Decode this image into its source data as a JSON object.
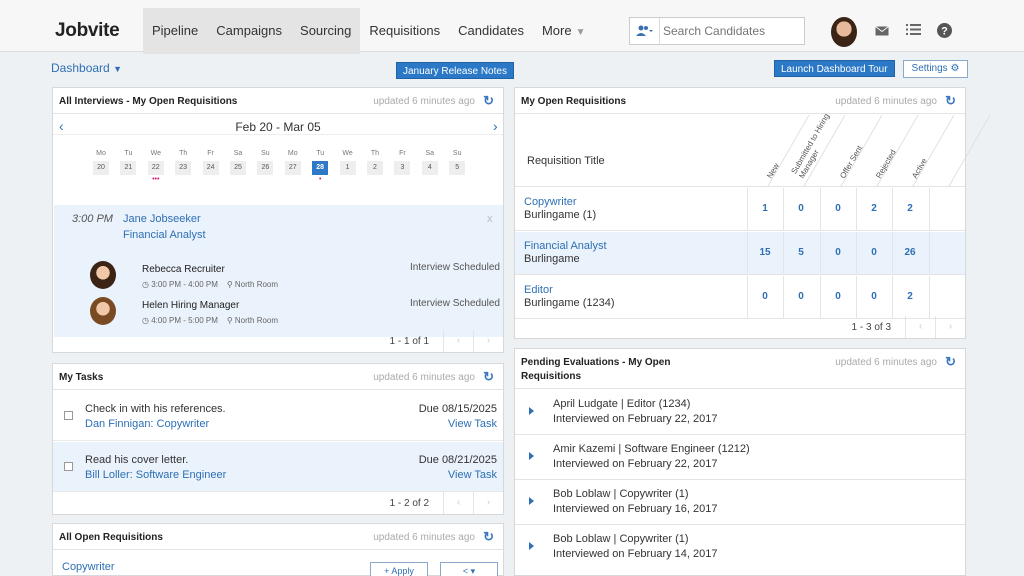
{
  "app": {
    "logo": "Jobvite"
  },
  "nav": {
    "items": [
      {
        "label": "Pipeline"
      },
      {
        "label": "Campaigns"
      },
      {
        "label": "Sourcing"
      },
      {
        "label": "Requisitions"
      },
      {
        "label": "Candidates"
      },
      {
        "label": "More"
      }
    ],
    "search_placeholder": "Search Candidates"
  },
  "toolbar": {
    "dashboard": "Dashboard",
    "release_notes": "January Release Notes",
    "launch_tour": "Launch Dashboard Tour",
    "settings": "Settings"
  },
  "interviews": {
    "title": "All Interviews - My Open Requisitions",
    "updated": "updated 6 minutes ago",
    "range": "Feb 20 - Mar 05",
    "days": [
      {
        "name": "Mo",
        "num": "20"
      },
      {
        "name": "Tu",
        "num": "21"
      },
      {
        "name": "We",
        "num": "22"
      },
      {
        "name": "Th",
        "num": "23"
      },
      {
        "name": "Fr",
        "num": "24"
      },
      {
        "name": "Sa",
        "num": "25"
      },
      {
        "name": "Su",
        "num": "26"
      },
      {
        "name": "Mo",
        "num": "27"
      },
      {
        "name": "Tu",
        "num": "28"
      },
      {
        "name": "We",
        "num": "1"
      },
      {
        "name": "Th",
        "num": "2"
      },
      {
        "name": "Fr",
        "num": "3"
      },
      {
        "name": "Sa",
        "num": "4"
      },
      {
        "name": "Su",
        "num": "5"
      }
    ],
    "dots_we": "•••",
    "dots_tu": "•",
    "time": "3:00 PM",
    "candidate": "Jane Jobseeker",
    "role": "Financial Analyst",
    "close": "x",
    "people": [
      {
        "name": "Rebecca Recruiter",
        "time": "3:00 PM - 4:00 PM",
        "room": "North Room",
        "status": "Interview Scheduled"
      },
      {
        "name": "Helen Hiring Manager",
        "time": "4:00 PM - 5:00 PM",
        "room": "North Room",
        "status": "Interview Scheduled"
      }
    ],
    "pager": "1 - 1 of 1"
  },
  "tasks": {
    "title": "My Tasks",
    "updated": "updated 6 minutes ago",
    "items": [
      {
        "text": "Check in with his references.",
        "link": "Dan Finnigan: Copywriter",
        "due": "Due 08/15/2025",
        "view": "View Task"
      },
      {
        "text": "Read his cover letter.",
        "link": "Bill Loller: Software Engineer",
        "due": "Due 08/21/2025",
        "view": "View Task"
      }
    ],
    "pager": "1 - 2 of 2"
  },
  "all_reqs": {
    "title": "All Open Requisitions",
    "updated": "updated 6 minutes ago",
    "first": "Copywriter",
    "apply": "+ Apply",
    "share": "< ▾"
  },
  "my_reqs": {
    "title": "My Open Requisitions",
    "updated": "updated 6 minutes ago",
    "col_title": "Requisition Title",
    "cols": [
      "New",
      "Submitted to Hiring Manager",
      "Offer Sent",
      "Rejected",
      "Active"
    ],
    "rows": [
      {
        "name": "Copywriter",
        "loc": "Burlingame (1)",
        "vals": [
          "1",
          "0",
          "0",
          "2",
          "2"
        ]
      },
      {
        "name": "Financial Analyst",
        "loc": "Burlingame",
        "vals": [
          "15",
          "5",
          "0",
          "0",
          "26"
        ]
      },
      {
        "name": "Editor",
        "loc": "Burlingame (1234)",
        "vals": [
          "0",
          "0",
          "0",
          "0",
          "2"
        ]
      }
    ],
    "pager": "1 - 3 of 3"
  },
  "evals": {
    "title_1": "Pending Evaluations - My Open",
    "title_2": "Requisitions",
    "updated": "updated 6 minutes ago",
    "items": [
      {
        "name": "April Ludgate | Editor (1234)",
        "date": "Interviewed on February 22, 2017"
      },
      {
        "name": "Amir Kazemi | Software Engineer (1212)",
        "date": "Interviewed on February 22, 2017"
      },
      {
        "name": "Bob Loblaw | Copywriter (1)",
        "date": "Interviewed on February 16, 2017"
      },
      {
        "name": "Bob Loblaw | Copywriter (1)",
        "date": "Interviewed on February 14, 2017"
      }
    ]
  },
  "icons": [
    "people-filter-icon",
    "mail-icon",
    "list-icon",
    "help-icon",
    "refresh-icon",
    "location-icon",
    "clock-icon"
  ]
}
